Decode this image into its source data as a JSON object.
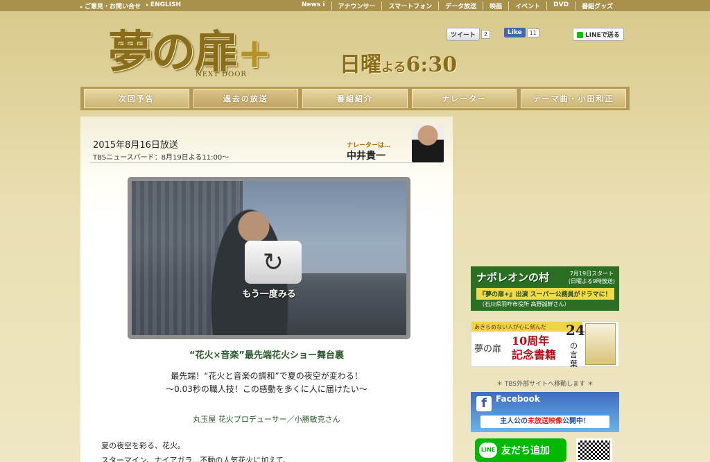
{
  "topbar": {
    "left": [
      "ご意見・お問い合せ",
      "ENGLISH"
    ],
    "right": [
      "News i",
      "アナウンサー",
      "スマートフォン",
      "データ放送",
      "映画",
      "イベント",
      "DVD",
      "番組グッズ"
    ]
  },
  "header": {
    "logo": "夢の扉",
    "logo_plus": "+",
    "logo_sub": "NEXT DOOR",
    "airtime_main": "日曜",
    "airtime_small": "よる",
    "airtime_time": "6:30",
    "tweet": "ツイート",
    "tweet_count": "2",
    "like": "Like",
    "like_count": "11",
    "line": "LINEで送る"
  },
  "nav": [
    "次回予告",
    "過去の放送",
    "番組紹介",
    "ナレーター",
    "テーマ曲・小田和正"
  ],
  "episode": {
    "date": "2015年8月16日放送",
    "rebroadcast": "TBSニュースバード：8月19日よる11:00～",
    "narrator_label": "ナレーターは…",
    "narrator_name": "中井貴一",
    "replay_label": "もう一度みる",
    "title": "“花火×音楽”最先端花火ショー舞台裏",
    "sub1": "最先端！“花火と音楽の調和”で夏の夜空が変わる！",
    "sub2": "～0.03秒の職人技！この感動を多くに人に届けたい～",
    "credit": "丸玉屋 花火プロデューサー／小勝敏克さん",
    "body1": "夏の夜空を彩る、花火。",
    "body2": "スターマイン、ナイアガラ…不動の人気花火に加えて、"
  },
  "sidebar": {
    "napo_title": "ナポレオンの村",
    "napo_start": "7月19日スタート",
    "napo_time": "(日曜よる9時放送)",
    "napo_tag": "『夢の扉+』出演 スーパー公務員がドラマに！",
    "napo_person": "（石川県羽咋市役所 高野誠鮮さん）",
    "book_top": "あきらめない人が心に刻んだ",
    "book_logo": "夢の扉",
    "book_ann1": "10周年",
    "book_ann2": "記念書籍",
    "book_num": "24",
    "book_words": "の言葉",
    "tbs_note": "＊ TBS外部サイトへ移動します ＊",
    "fb_title": "Facebook",
    "fb_body_pre": "主人公の",
    "fb_body_em": "未放送映像",
    "fb_body_post": "公開中！",
    "line_label": "友だち追加",
    "line_icon": "LINE"
  }
}
